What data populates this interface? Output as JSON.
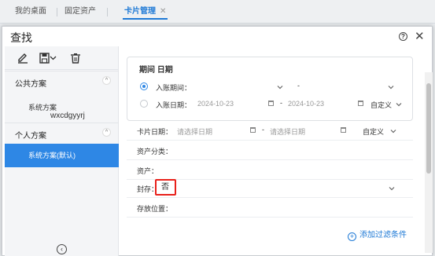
{
  "tabs": [
    {
      "label": "我的桌面"
    },
    {
      "label": "固定资产"
    },
    {
      "label": "卡片管理",
      "close": "✕"
    }
  ],
  "dialog": {
    "title": "查找",
    "help_icon": "question-circle-icon",
    "close_icon": "close-icon"
  },
  "sidebar": {
    "toolbar_icons": [
      "pencil-icon",
      "save-icon",
      "trash-icon"
    ],
    "public_section": "公共方案",
    "public_items": [
      "系统方案"
    ],
    "personal_section": "个人方案",
    "personal_items": [
      "系统方案(默认)"
    ],
    "watermark": "wxcdgyyrj"
  },
  "period": {
    "title": "期间 日期",
    "opt1_label": "入账期间：",
    "opt1_from": "",
    "opt1_sep": "-",
    "opt1_to": "",
    "opt2_label": "入账日期：",
    "opt2_from": "2024-10-23",
    "opt2_sep": "-",
    "opt2_to": "2024-10-23",
    "opt2_mode": "自定义",
    "selected": "opt1"
  },
  "fields": {
    "card_date_label": "卡片日期：",
    "card_date_from_placeholder": "请选择日期",
    "card_date_sep": "-",
    "card_date_to_placeholder": "请选择日期",
    "card_date_mode": "自定义",
    "asset_category_label": "资产分类：",
    "asset_label": "资产：",
    "sealed_label": "封存：",
    "sealed_value": "否",
    "storage_label": "存放位置："
  },
  "add_filter": "添加过滤条件",
  "colors": {
    "accent": "#2e87e5",
    "highlight_border": "#e8201a"
  }
}
